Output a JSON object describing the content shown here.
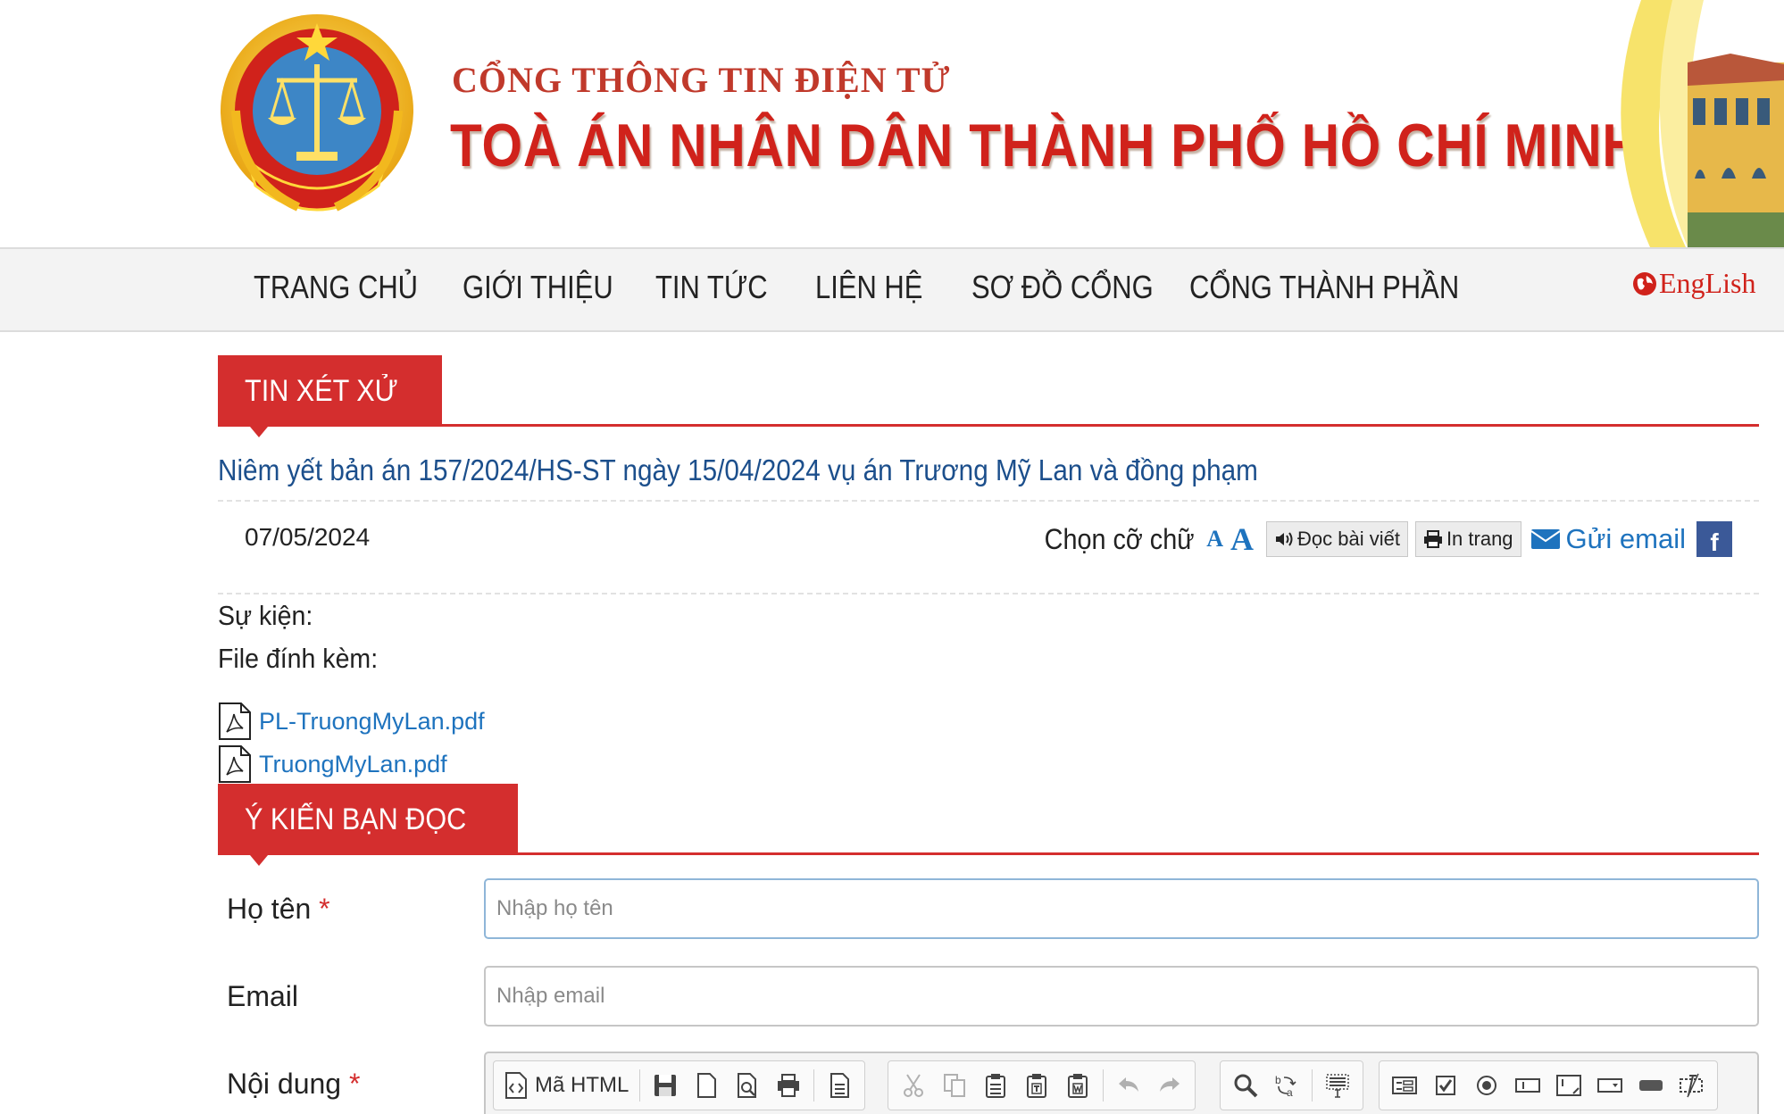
{
  "header": {
    "subtitle": "CỔNG THÔNG TIN ĐIỆN TỬ",
    "title": "TOÀ ÁN NHÂN DÂN THÀNH PHỐ HỒ CHÍ MINH"
  },
  "nav": {
    "items": [
      "TRANG CHỦ",
      "GIỚI THIỆU",
      "TIN TỨC",
      "LIÊN HỆ",
      "SƠ ĐỒ CỔNG",
      "CỔNG THÀNH PHẦN"
    ],
    "language": "EngLish"
  },
  "section": {
    "label": "TIN XÉT XỬ"
  },
  "article": {
    "title": "Niêm yết bản án 157/2024/HS-ST ngày 15/04/2024 vụ án Trương Mỹ Lan và đồng phạm",
    "date": "07/05/2024",
    "tools": {
      "font_size_label": "Chọn cỡ chữ",
      "font_small": "A",
      "font_large": "A",
      "read_label": "Đọc bài viết",
      "print_label": "In trang",
      "email_label": "Gửi email",
      "facebook_label": "f"
    },
    "event_label": "Sự kiện:",
    "attachments_label": "File đính kèm:",
    "attachments": [
      "PL-TruongMyLan.pdf",
      "TruongMyLan.pdf"
    ]
  },
  "comments": {
    "label": "Ý KIẾN BẠN ĐỌC",
    "name_label": "Họ tên",
    "name_placeholder": "Nhập họ tên",
    "email_label": "Email",
    "email_placeholder": "Nhập email",
    "content_label": "Nội dung",
    "required_mark": "*",
    "editor": {
      "source_label": "Mã HTML"
    }
  },
  "colors": {
    "brand_red": "#d42e2e",
    "link_blue": "#1e73be",
    "title_blue": "#1c4f8c"
  }
}
